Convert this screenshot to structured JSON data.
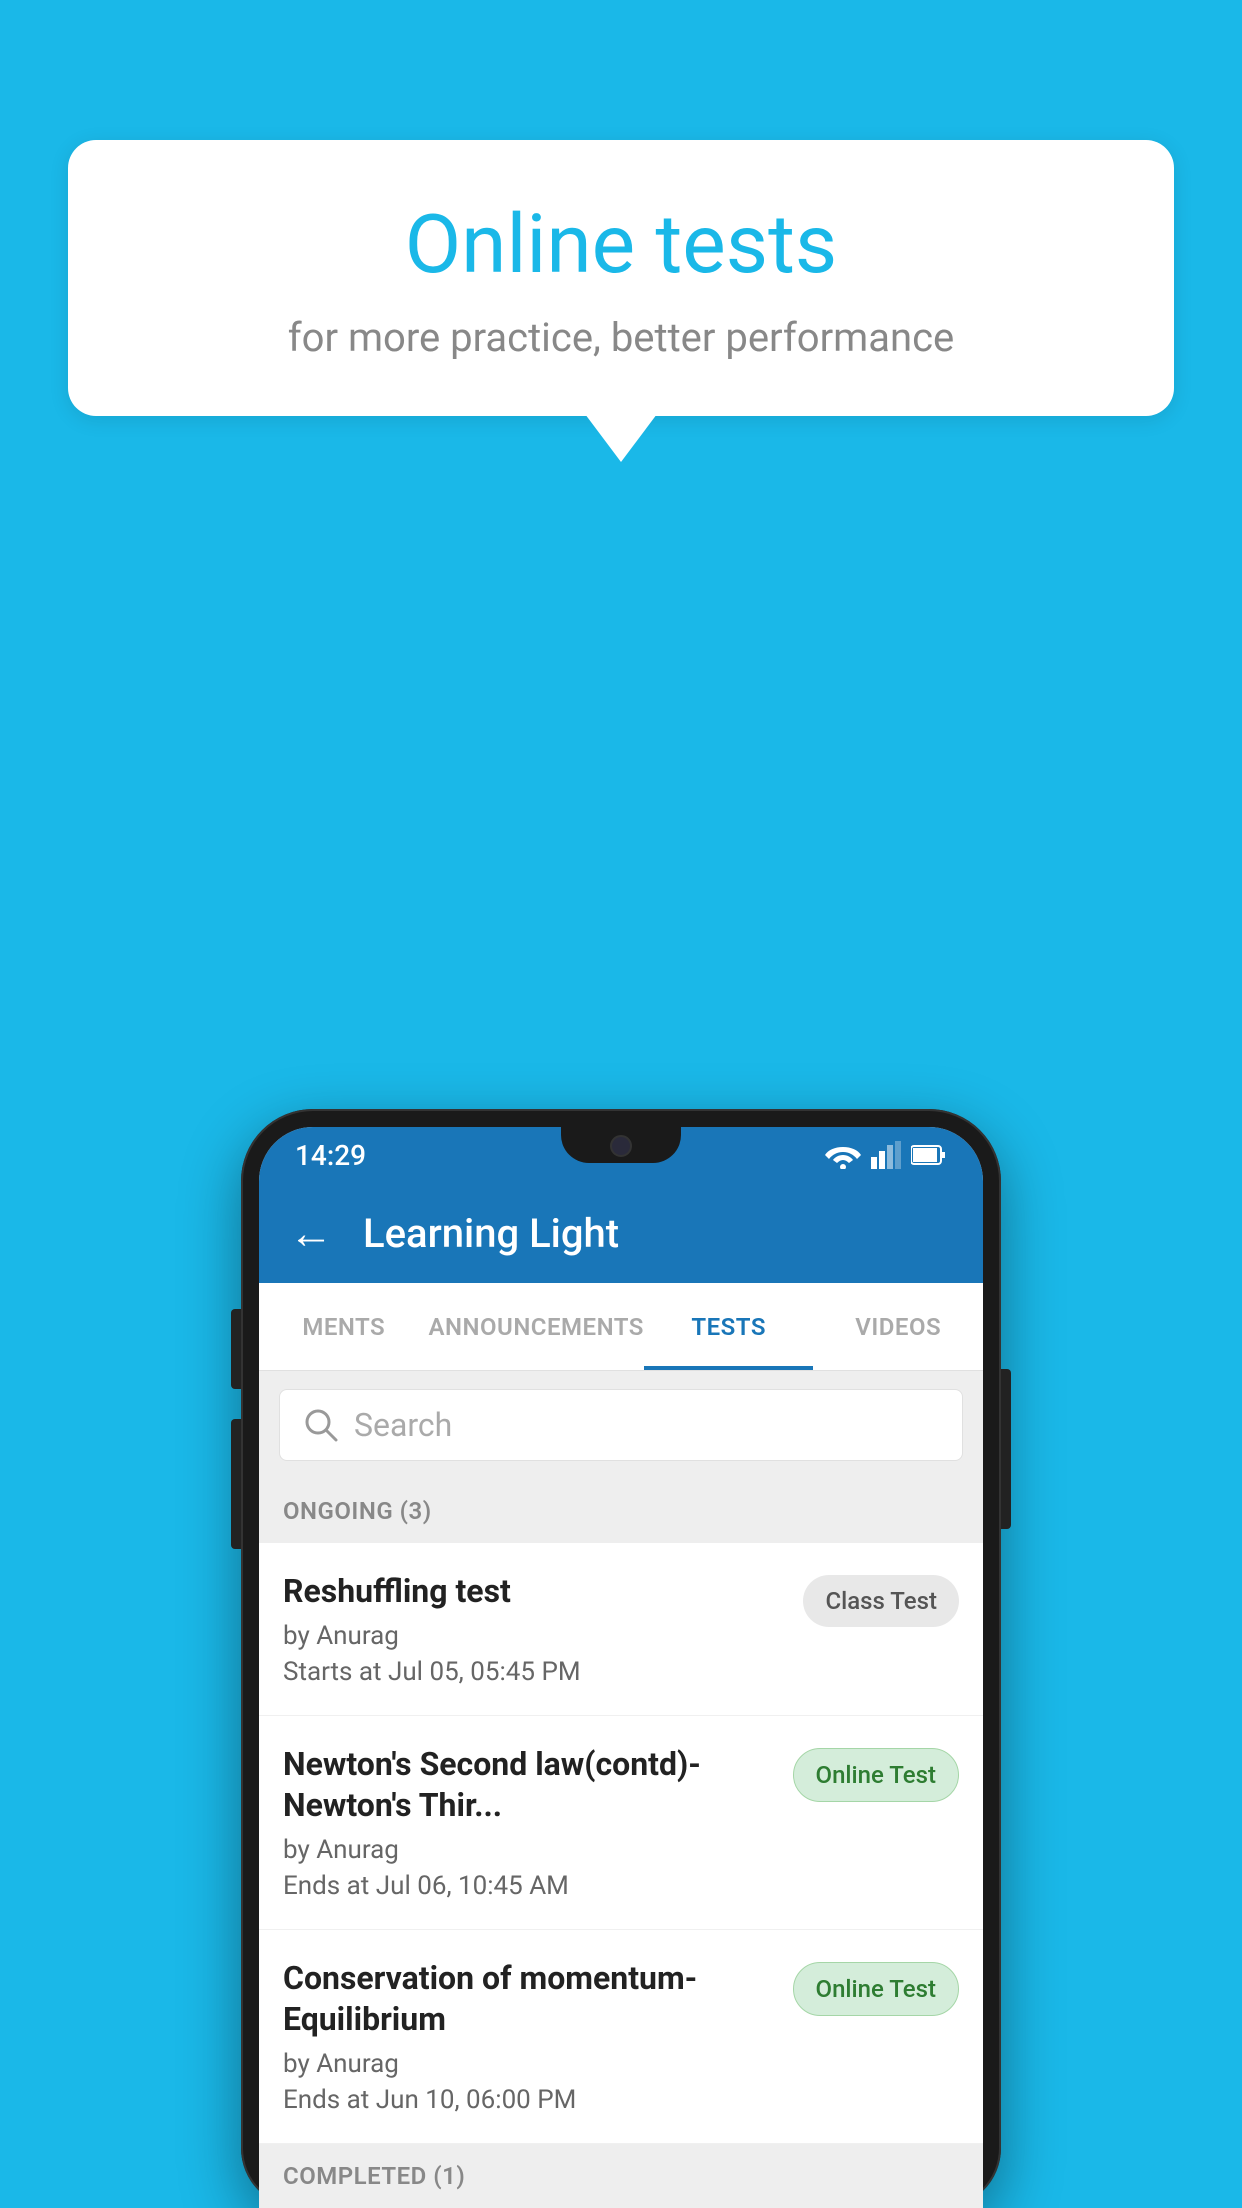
{
  "background": {
    "color": "#1ab8e8"
  },
  "speech_bubble": {
    "title": "Online tests",
    "subtitle": "for more practice, better performance"
  },
  "status_bar": {
    "time": "14:29"
  },
  "app_bar": {
    "title": "Learning Light",
    "back_icon": "←"
  },
  "tabs": [
    {
      "label": "MENTS",
      "active": false
    },
    {
      "label": "ANNOUNCEMENTS",
      "active": false
    },
    {
      "label": "TESTS",
      "active": true
    },
    {
      "label": "VIDEOS",
      "active": false
    }
  ],
  "search": {
    "placeholder": "Search"
  },
  "ongoing_section": {
    "label": "ONGOING (3)"
  },
  "tests": [
    {
      "title": "Reshuffling test",
      "author": "by Anurag",
      "date": "Starts at  Jul 05, 05:45 PM",
      "badge": "Class Test",
      "badge_type": "class"
    },
    {
      "title": "Newton's Second law(contd)-Newton's Thir...",
      "author": "by Anurag",
      "date": "Ends at  Jul 06, 10:45 AM",
      "badge": "Online Test",
      "badge_type": "online"
    },
    {
      "title": "Conservation of momentum-Equilibrium",
      "author": "by Anurag",
      "date": "Ends at  Jun 10, 06:00 PM",
      "badge": "Online Test",
      "badge_type": "online"
    }
  ],
  "completed_section": {
    "label": "COMPLETED (1)"
  }
}
